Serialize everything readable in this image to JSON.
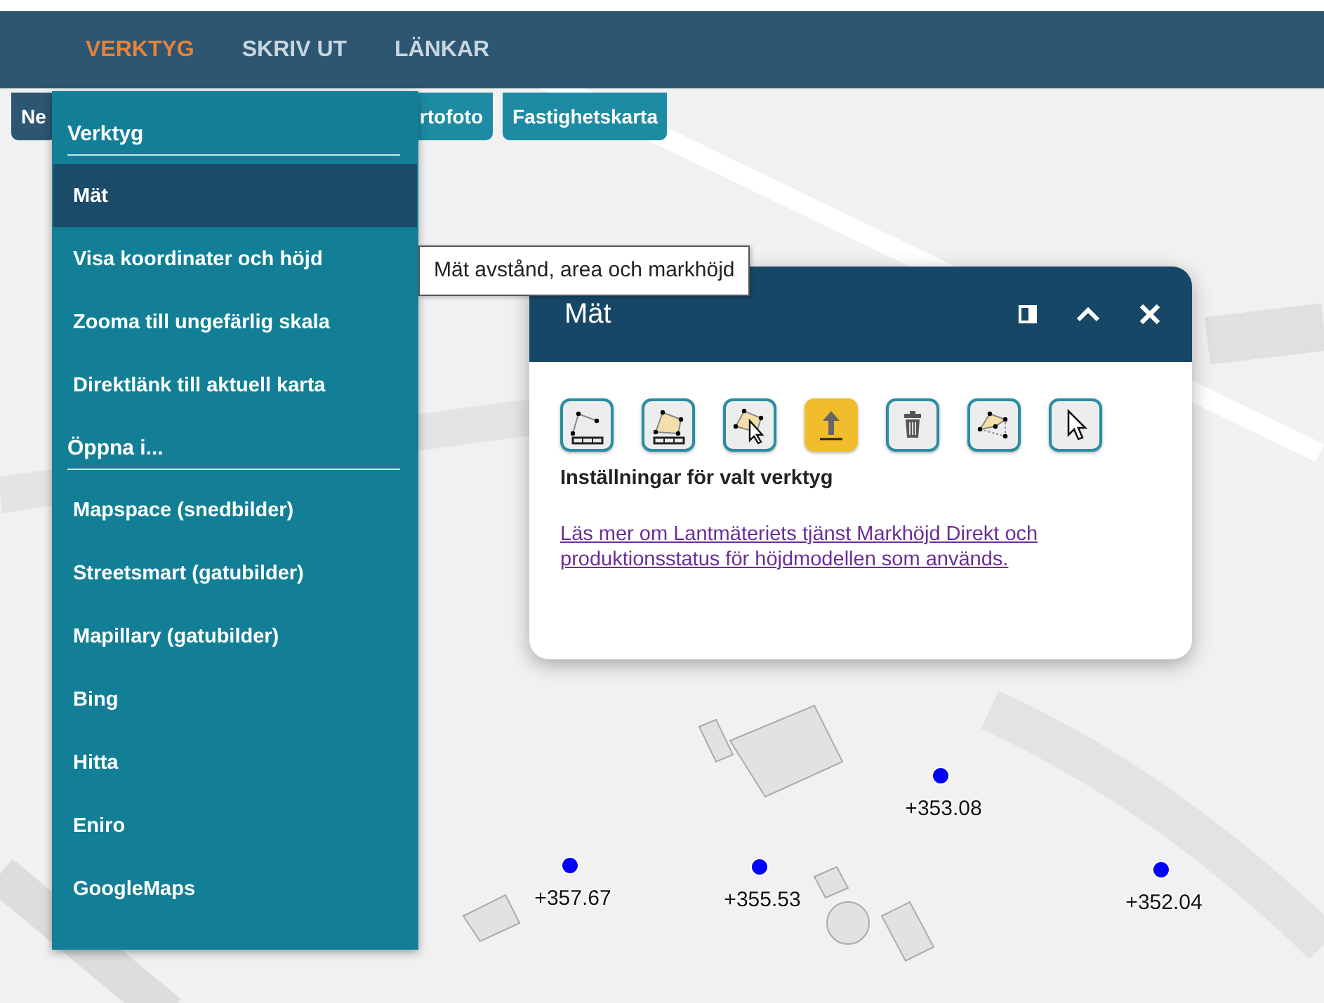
{
  "nav": {
    "tabs": [
      {
        "label": "VERKTYG",
        "selected": true
      },
      {
        "label": "SKRIV UT",
        "selected": false
      },
      {
        "label": "LÄNKAR",
        "selected": false
      }
    ]
  },
  "layers": [
    {
      "label": "Ne",
      "selected": true
    },
    {
      "label": "rtofoto",
      "selected": false
    },
    {
      "label": "Fastighetskarta",
      "selected": false
    }
  ],
  "menu": {
    "sections": [
      {
        "title": "Verktyg",
        "items": [
          {
            "label": "Mät",
            "selected": true
          },
          {
            "label": "Visa koordinater och höjd",
            "selected": false
          },
          {
            "label": "Zooma till ungefärlig skala",
            "selected": false
          },
          {
            "label": "Direktlänk till aktuell karta",
            "selected": false
          }
        ]
      },
      {
        "title": "Öppna i...",
        "items": [
          {
            "label": "Mapspace (snedbilder)",
            "selected": false
          },
          {
            "label": "Streetsmart (gatubilder)",
            "selected": false
          },
          {
            "label": "Mapillary (gatubilder)",
            "selected": false
          },
          {
            "label": "Bing",
            "selected": false
          },
          {
            "label": "Hitta",
            "selected": false
          },
          {
            "label": "Eniro",
            "selected": false
          },
          {
            "label": "GoogleMaps",
            "selected": false
          }
        ]
      }
    ]
  },
  "tooltip": {
    "text": "Mät avstånd, area och markhöjd"
  },
  "dialog": {
    "title": "Mät",
    "tools": [
      {
        "kind": "line",
        "selected": false
      },
      {
        "kind": "area",
        "selected": false
      },
      {
        "kind": "area-select",
        "selected": false
      },
      {
        "kind": "height",
        "selected": true
      },
      {
        "kind": "delete",
        "selected": false
      },
      {
        "kind": "edit",
        "selected": false
      },
      {
        "kind": "pointer",
        "selected": false
      }
    ],
    "settings_label": "Inställningar för valt verktyg",
    "link": "Läs mer om Lantmäteriets tjänst Markhöjd Direkt och produktionsstatus för höjdmodellen som används."
  },
  "map": {
    "kind": "picture",
    "points": [
      {
        "label": "+357.67"
      },
      {
        "label": "+355.53"
      },
      {
        "label": "+353.08"
      },
      {
        "label": "+352.04"
      }
    ]
  }
}
